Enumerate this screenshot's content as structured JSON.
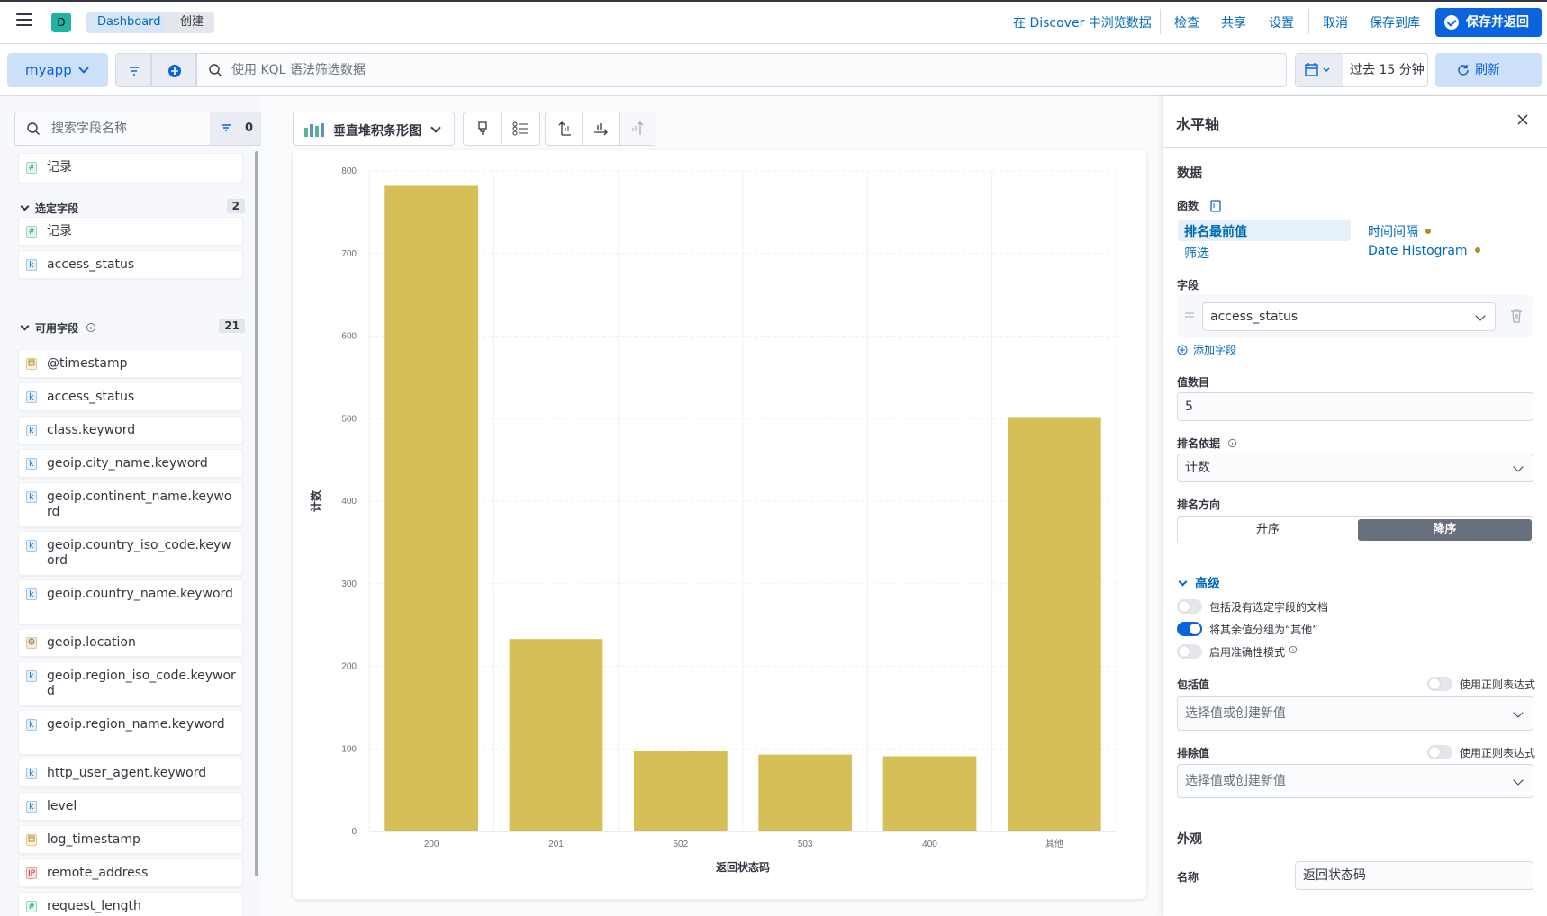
{
  "header": {
    "space_initial": "D",
    "breadcrumbs": [
      "Dashboard",
      "创建"
    ],
    "links": [
      "在 Discover 中浏览数据",
      "检查",
      "共享",
      "设置",
      "取消",
      "保存到库"
    ],
    "save_return": "保存并返回"
  },
  "query": {
    "dataview": "myapp",
    "kql_placeholder": "使用 KQL 语法筛选数据",
    "time": "过去 15 分钟",
    "refresh": "刷新"
  },
  "fields": {
    "search_placeholder": "搜索字段名称",
    "filter_count": "0",
    "records": "记录",
    "selected_title": "选定字段",
    "selected_count": "2",
    "selected": [
      {
        "t": "#",
        "name": "记录"
      },
      {
        "t": "k",
        "name": "access_status"
      }
    ],
    "available_title": "可用字段",
    "available_count": "21",
    "available": [
      {
        "t": "d",
        "name": "@timestamp"
      },
      {
        "t": "k",
        "name": "access_status"
      },
      {
        "t": "k",
        "name": "class.keyword"
      },
      {
        "t": "k",
        "name": "geoip.city_name.keyword"
      },
      {
        "t": "k",
        "name": "geoip.continent_name.keyword"
      },
      {
        "t": "k",
        "name": "geoip.country_iso_code.keyword"
      },
      {
        "t": "k",
        "name": "geoip.country_name.keyword"
      },
      {
        "t": "g",
        "name": "geoip.location"
      },
      {
        "t": "k",
        "name": "geoip.region_iso_code.keyword"
      },
      {
        "t": "k",
        "name": "geoip.region_name.keyword"
      },
      {
        "t": "k",
        "name": "http_user_agent.keyword"
      },
      {
        "t": "k",
        "name": "level"
      },
      {
        "t": "d",
        "name": "log_timestamp"
      },
      {
        "t": "ip",
        "name": "remote_address"
      },
      {
        "t": "#",
        "name": "request_length"
      }
    ]
  },
  "toolbar": {
    "chart_type": "垂直堆积条形图"
  },
  "chart_data": {
    "type": "bar",
    "categories": [
      "200",
      "201",
      "502",
      "503",
      "400",
      "其他"
    ],
    "values": [
      782,
      233,
      97,
      93,
      91,
      502
    ],
    "xlabel": "返回状态码",
    "ylabel": "计数",
    "ylim": [
      0,
      800
    ],
    "yticks": [
      0,
      100,
      200,
      300,
      400,
      500,
      600,
      700,
      800
    ],
    "color": "#d6bf57",
    "grid": true
  },
  "panel": {
    "title": "水平轴",
    "data_title": "数据",
    "function_label": "函数",
    "functions": [
      "排名最前值",
      "时间间隔",
      "筛选",
      "Date Histogram"
    ],
    "field_label": "字段",
    "field_value": "access_status",
    "add_field": "添加字段",
    "count_label": "值数目",
    "count_value": "5",
    "rank_by_label": "排名依据",
    "rank_by_value": "计数",
    "direction_label": "排名方向",
    "asc": "升序",
    "desc": "降序",
    "advanced": "高级",
    "toggles": [
      {
        "label": "包括没有选定字段的文档",
        "on": false
      },
      {
        "label": "将其余值分组为“其他”",
        "on": true
      },
      {
        "label": "启用准确性模式",
        "on": false
      }
    ],
    "include_label": "包括值",
    "exclude_label": "排除值",
    "regex_label": "使用正则表达式",
    "select_placeholder": "选择值或创建新值",
    "appearance": "外观",
    "name_label": "名称",
    "name_value": "返回状态码"
  }
}
